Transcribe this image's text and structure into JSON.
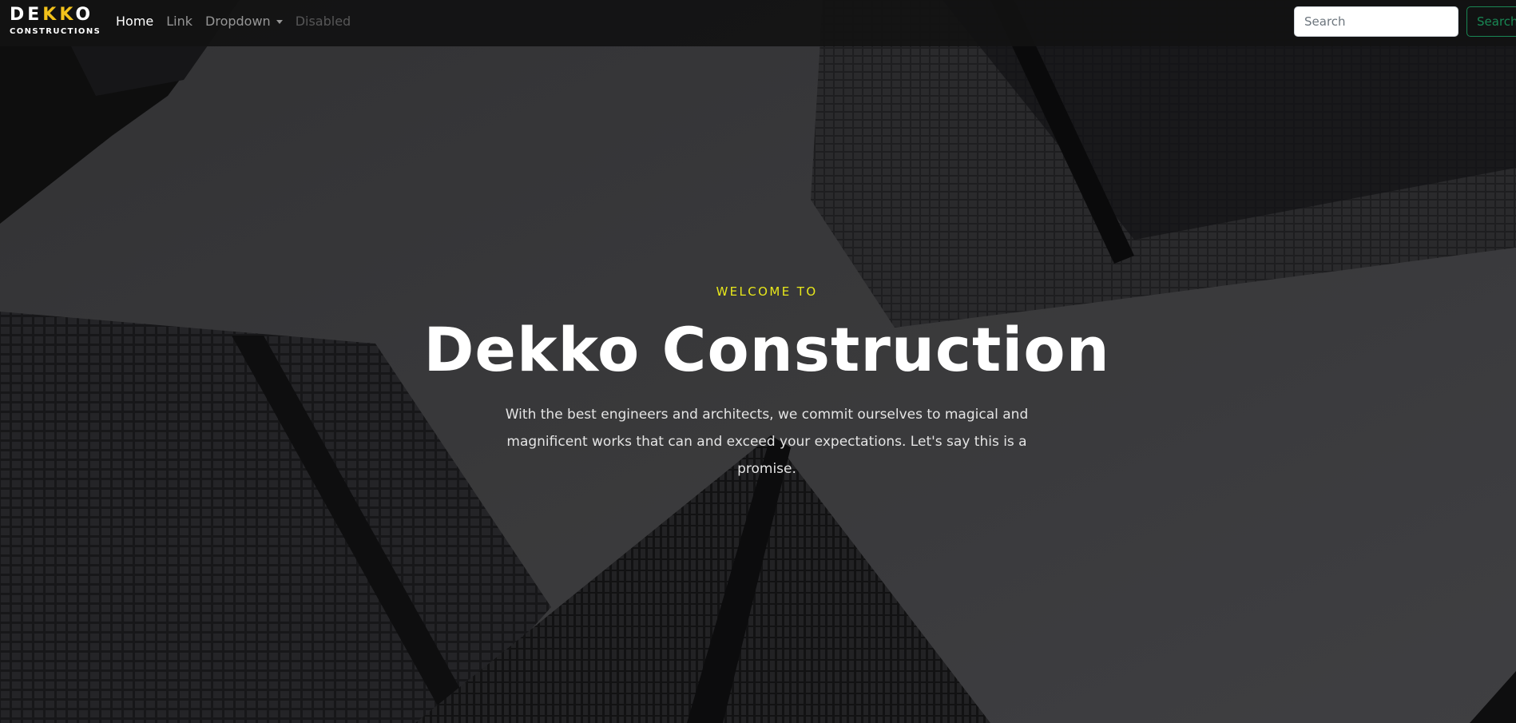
{
  "brand": {
    "top_parts": [
      "DE",
      "KK",
      "O"
    ],
    "bottom": "CONSTRUCTIONS"
  },
  "nav": {
    "items": [
      {
        "label": "Home",
        "state": "active"
      },
      {
        "label": "Link",
        "state": "normal"
      },
      {
        "label": "Dropdown",
        "state": "dropdown"
      },
      {
        "label": "Disabled",
        "state": "disabled"
      }
    ]
  },
  "search": {
    "placeholder": "Search",
    "button_label": "Search"
  },
  "hero": {
    "kicker": "WELCOME TO",
    "title": "Dekko Construction",
    "line1": "With the best engineers and architects, we commit ourselves to magical and",
    "line2": "magnificent works that can and exceed your expectations. Let's say this is a promise."
  },
  "colors": {
    "brand_yellow": "#f2c21b",
    "kicker_yellow": "#e8e81b",
    "search_green": "#198754",
    "navbar_bg": "#121212"
  }
}
